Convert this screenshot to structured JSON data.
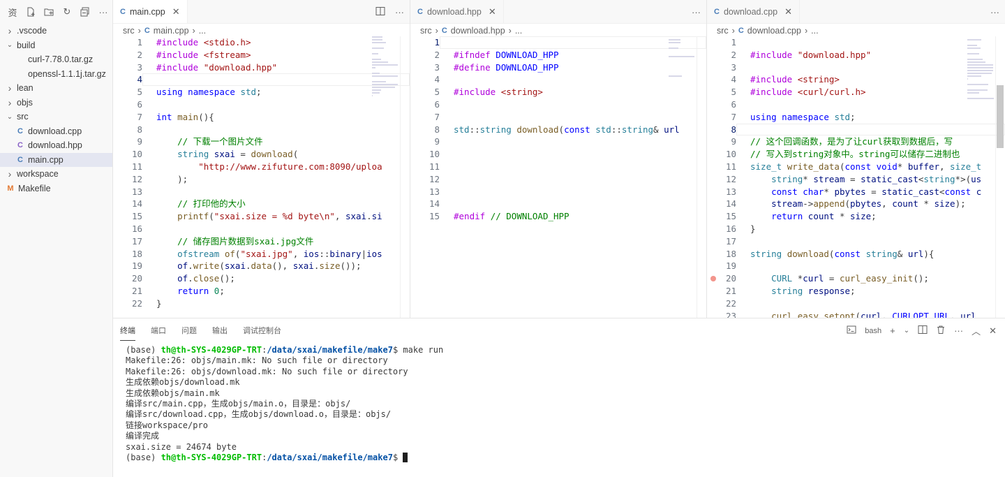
{
  "explorer": {
    "items": [
      {
        "label": ".vscode",
        "kind": "folder",
        "expanded": false,
        "depth": 0
      },
      {
        "label": "build",
        "kind": "folder",
        "expanded": true,
        "depth": 0
      },
      {
        "label": "curl-7.78.0.tar.gz",
        "kind": "file",
        "depth": 1
      },
      {
        "label": "openssl-1.1.1j.tar.gz",
        "kind": "file",
        "depth": 1
      },
      {
        "label": "lean",
        "kind": "folder",
        "expanded": false,
        "depth": 0
      },
      {
        "label": "objs",
        "kind": "folder",
        "expanded": false,
        "depth": 0
      },
      {
        "label": "src",
        "kind": "folder",
        "expanded": true,
        "depth": 0
      },
      {
        "label": "download.cpp",
        "kind": "cpp",
        "depth": 1
      },
      {
        "label": "download.hpp",
        "kind": "hpp",
        "depth": 1
      },
      {
        "label": "main.cpp",
        "kind": "cpp",
        "depth": 1,
        "selected": true
      },
      {
        "label": "workspace",
        "kind": "folder",
        "expanded": false,
        "depth": 0
      },
      {
        "label": "Makefile",
        "kind": "make",
        "depth": 0
      }
    ]
  },
  "editors": [
    {
      "tab": "main.cpp",
      "breadcrumb": [
        "src",
        "main.cpp",
        "..."
      ],
      "active_line": 4,
      "lines": [
        {
          "n": 1,
          "code": "#include <stdio.h>"
        },
        {
          "n": 2,
          "code": "#include <fstream>"
        },
        {
          "n": 3,
          "code": "#include \"download.hpp\""
        },
        {
          "n": 4,
          "code": ""
        },
        {
          "n": 5,
          "code": "using namespace std;"
        },
        {
          "n": 6,
          "code": ""
        },
        {
          "n": 7,
          "code": "int main(){"
        },
        {
          "n": 8,
          "code": ""
        },
        {
          "n": 9,
          "code": "    // 下载一个图片文件"
        },
        {
          "n": 10,
          "code": "    string sxai = download("
        },
        {
          "n": 11,
          "code": "        \"http://www.zifuture.com:8090/uploa"
        },
        {
          "n": 12,
          "code": "    );"
        },
        {
          "n": 13,
          "code": ""
        },
        {
          "n": 14,
          "code": "    // 打印他的大小"
        },
        {
          "n": 15,
          "code": "    printf(\"sxai.size = %d byte\\n\", sxai.si"
        },
        {
          "n": 16,
          "code": ""
        },
        {
          "n": 17,
          "code": "    // 储存图片数据到sxai.jpg文件"
        },
        {
          "n": 18,
          "code": "    ofstream of(\"sxai.jpg\", ios::binary|ios"
        },
        {
          "n": 19,
          "code": "    of.write(sxai.data(), sxai.size());"
        },
        {
          "n": 20,
          "code": "    of.close();"
        },
        {
          "n": 21,
          "code": "    return 0;"
        },
        {
          "n": 22,
          "code": "}"
        }
      ]
    },
    {
      "tab": "download.hpp",
      "breadcrumb": [
        "src",
        "download.hpp",
        "..."
      ],
      "active_line": 1,
      "lines": [
        {
          "n": 1,
          "code": ""
        },
        {
          "n": 2,
          "code": "#ifndef DOWNLOAD_HPP"
        },
        {
          "n": 3,
          "code": "#define DOWNLOAD_HPP"
        },
        {
          "n": 4,
          "code": ""
        },
        {
          "n": 5,
          "code": "#include <string>"
        },
        {
          "n": 6,
          "code": ""
        },
        {
          "n": 7,
          "code": ""
        },
        {
          "n": 8,
          "code": "std::string download(const std::string& url"
        },
        {
          "n": 9,
          "code": ""
        },
        {
          "n": 10,
          "code": ""
        },
        {
          "n": 11,
          "code": ""
        },
        {
          "n": 12,
          "code": ""
        },
        {
          "n": 13,
          "code": ""
        },
        {
          "n": 14,
          "code": ""
        },
        {
          "n": 15,
          "code": "#endif // DOWNLOAD_HPP"
        }
      ]
    },
    {
      "tab": "download.cpp",
      "breadcrumb": [
        "src",
        "download.cpp",
        "..."
      ],
      "active_line": 8,
      "breakpoint_line": 20,
      "lines": [
        {
          "n": 1,
          "code": ""
        },
        {
          "n": 2,
          "code": "#include \"download.hpp\""
        },
        {
          "n": 3,
          "code": ""
        },
        {
          "n": 4,
          "code": "#include <string>"
        },
        {
          "n": 5,
          "code": "#include <curl/curl.h>"
        },
        {
          "n": 6,
          "code": ""
        },
        {
          "n": 7,
          "code": "using namespace std;"
        },
        {
          "n": 8,
          "code": ""
        },
        {
          "n": 9,
          "code": "// 这个回调函数，是为了让curl获取到数据后，写"
        },
        {
          "n": 10,
          "code": "// 写入到string对象中。string可以储存二进制也"
        },
        {
          "n": 11,
          "code": "size_t write_data(const void* buffer, size_t"
        },
        {
          "n": 12,
          "code": "    string* stream = static_cast<string*>(us"
        },
        {
          "n": 13,
          "code": "    const char* pbytes = static_cast<const c"
        },
        {
          "n": 14,
          "code": "    stream->append(pbytes, count * size);"
        },
        {
          "n": 15,
          "code": "    return count * size;"
        },
        {
          "n": 16,
          "code": "}"
        },
        {
          "n": 17,
          "code": ""
        },
        {
          "n": 18,
          "code": "string download(const string& url){"
        },
        {
          "n": 19,
          "code": ""
        },
        {
          "n": 20,
          "code": "    CURL *curl = curl_easy_init();"
        },
        {
          "n": 21,
          "code": "    string response;"
        },
        {
          "n": 22,
          "code": ""
        },
        {
          "n": 23,
          "code": "    curl_easy_setopt(curl, CURLOPT_URL, url..."
        }
      ]
    }
  ],
  "panel": {
    "tabs": [
      "终端",
      "端口",
      "问题",
      "输出",
      "调试控制台"
    ],
    "active_tab": "终端",
    "shell": "bash",
    "prompt_user": "th@th-SYS-4029GP-TRT",
    "prompt_path": "/data/sxai/makefile/make7",
    "command": "make run",
    "output": [
      "Makefile:26: objs/main.mk: No such file or directory",
      "Makefile:26: objs/download.mk: No such file or directory",
      "生成依赖objs/download.mk",
      "生成依赖objs/main.mk",
      "编译src/main.cpp，生成objs/main.o，目录是：objs/",
      "编译src/download.cpp，生成objs/download.o，目录是：objs/",
      "链接workspace/pro",
      "编译完成",
      "sxai.size = 24674 byte"
    ]
  }
}
